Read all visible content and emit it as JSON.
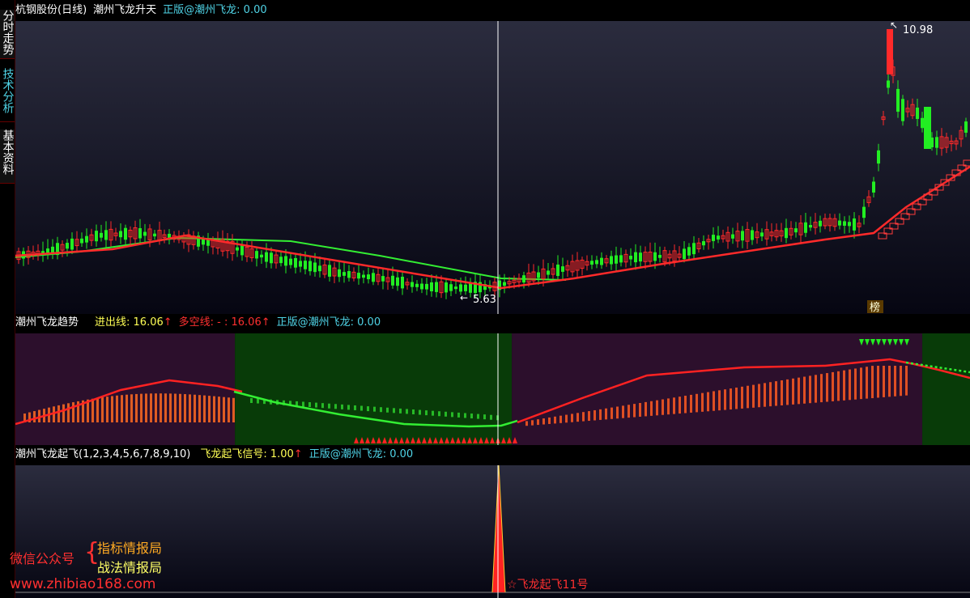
{
  "sidebar": {
    "tabs": [
      {
        "label": "分时走势",
        "active": false
      },
      {
        "label": "技术分析",
        "active": true
      },
      {
        "label": "基本资料",
        "active": false
      }
    ]
  },
  "panel1": {
    "stock_title": "杭钢股份(日线)",
    "formula_name": "潮州飞龙升天",
    "copyright": "正版@潮州飞龙: 0.00"
  },
  "panel2": {
    "formula_name": "潮州飞龙趋势",
    "entry_line": "进出线: 16.06",
    "multi_line": "多空线: - : 16.06",
    "copyright": "正版@潮州飞龙: 0.00",
    "arrow_glyph": "↑"
  },
  "panel3": {
    "formula_name": "潮州飞龙起飞(1,2,3,4,5,6,7,8,9,10)",
    "signal": "飞龙起飞信号: 1.00",
    "copyright": "正版@潮州飞龙: 0.00",
    "arrow_glyph": "↑",
    "signal_label": "☆飞龙起飞11号"
  },
  "watermark": {
    "wechat_label": "微信公众号",
    "brace": "{",
    "line1": "指标情报局",
    "line2": "战法情报局",
    "url": "www.zhibiao168.com"
  },
  "colors": {
    "up": "#ff2a2a",
    "down": "#22ee22",
    "cyan": "#4fd3e6",
    "yellow": "#ffff55",
    "panel_bg_top": "#2b2c3e",
    "purple_zone": "#2c0f2c",
    "green_zone": "#083b08"
  },
  "chart_data": [
    {
      "type": "candlestick",
      "name": "main",
      "annotations": {
        "high_label": "10.98",
        "low_label": "5.63",
        "badge": "榜"
      },
      "high": 10.98,
      "low": 5.63
    },
    {
      "type": "line",
      "name": "trend",
      "zones": [
        {
          "color": "purple",
          "from": 0,
          "to": 0.23
        },
        {
          "color": "green",
          "from": 0.23,
          "to": 0.52
        },
        {
          "color": "purple",
          "from": 0.52,
          "to": 0.95
        },
        {
          "color": "green",
          "from": 0.95,
          "to": 1
        }
      ]
    },
    {
      "type": "bar",
      "name": "signal",
      "spike_value": 1.0
    }
  ]
}
